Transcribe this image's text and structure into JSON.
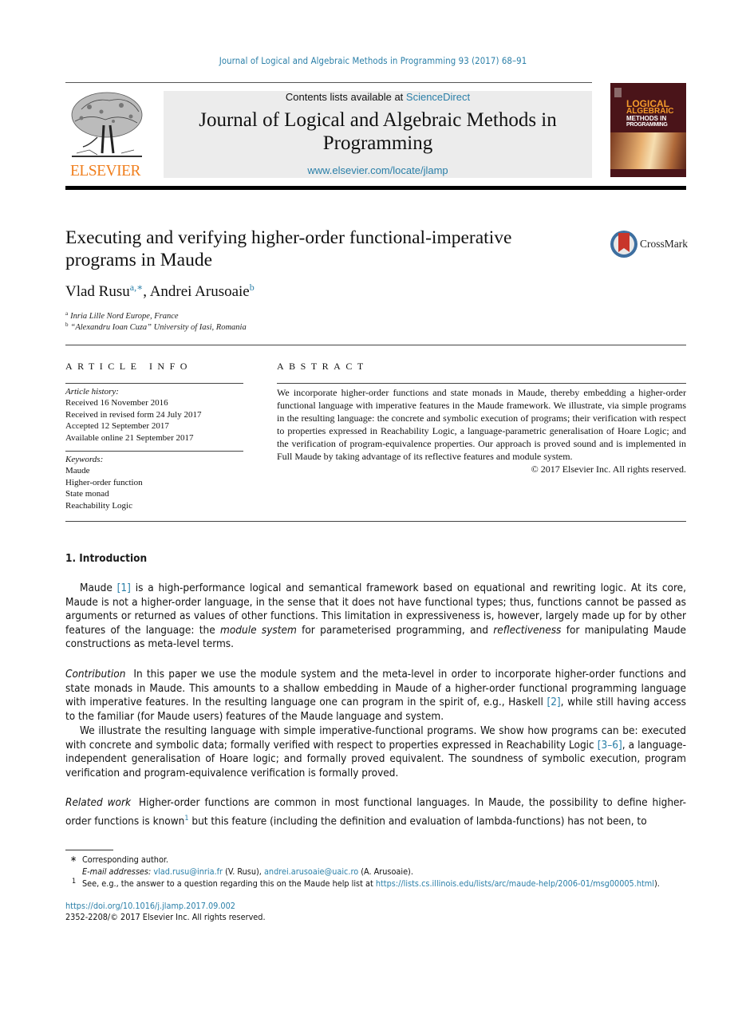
{
  "running_head": "Journal of Logical and Algebraic Methods in Programming 93 (2017) 68–91",
  "publisher": {
    "logo_word": "ELSEVIER",
    "contents_prefix": "Contents lists available at ",
    "contents_link": "ScienceDirect",
    "journal_title_line1": "Journal of Logical and Algebraic Methods in",
    "journal_title_line2": "Programming",
    "journal_url": "www.elsevier.com/locate/jlamp"
  },
  "cover": {
    "line1": "LOGICAL",
    "line2": "ALGEBRAIC",
    "line3": "METHODS IN",
    "line4": "PROGRAMMING",
    "colors": {
      "background": "#4a1419",
      "title_accent": "#f39a2b"
    }
  },
  "crossmark_label": "CrossMark",
  "article": {
    "title_line1": "Executing and verifying higher-order functional-imperative",
    "title_line2": "programs in Maude",
    "authors": [
      {
        "name": "Vlad Rusu",
        "marks": "a,∗"
      },
      {
        "name": "Andrei Arusoaie",
        "marks": "b"
      }
    ],
    "affiliations": [
      {
        "mark": "a",
        "text": "Inria Lille Nord Europe, France"
      },
      {
        "mark": "b",
        "text": "“Alexandru Ioan Cuza” University of Iasi, Romania"
      }
    ]
  },
  "article_info": {
    "heading": "ARTICLE INFO",
    "history_label": "Article history:",
    "history": [
      "Received 16 November 2016",
      "Received in revised form 24 July 2017",
      "Accepted 12 September 2017",
      "Available online 21 September 2017"
    ],
    "keywords_label": "Keywords:",
    "keywords": [
      "Maude",
      "Higher-order function",
      "State monad",
      "Reachability Logic"
    ]
  },
  "abstract": {
    "heading": "ABSTRACT",
    "text": "We incorporate higher-order functions and state monads in Maude, thereby embedding a higher-order functional language with imperative features in the Maude framework. We illustrate, via simple programs in the resulting language: the concrete and symbolic execution of programs; their verification with respect to properties expressed in Reachability Logic, a language-parametric generalisation of Hoare Logic; and the verification of program-equivalence properties. Our approach is proved sound and is implemented in Full Maude by taking advantage of its reflective features and module system.",
    "copyright": "© 2017 Elsevier Inc. All rights reserved."
  },
  "intro": {
    "heading": "1. Introduction",
    "p1_a": "Maude ",
    "p1_ref": "[1]",
    "p1_b": " is a high-performance logical and semantical framework based on equational and rewriting logic. At its core, Maude is not a higher-order language, in the sense that it does not have functional types; thus, functions cannot be passed as arguments or returned as values of other functions. This limitation in expressiveness is, however, largely made up for by other features of the language: the ",
    "p1_em1": "module system",
    "p1_c": " for parameterised programming, and ",
    "p1_em2": "reflectiveness",
    "p1_d": " for manipulating Maude constructions as meta-level terms.",
    "contrib_label": "Contribution",
    "p2_a": "In this paper we use the module system and the meta-level in order to incorporate higher-order functions and state monads in Maude. This amounts to a shallow embedding in Maude of a higher-order functional programming language with imperative features. In the resulting language one can program in the spirit of, e.g., Haskell ",
    "p2_ref": "[2]",
    "p2_b": ", while still having access to the familiar (for Maude users) features of the Maude language and system.",
    "p3_a": "We illustrate the resulting language with simple imperative-functional programs. We show how programs can be: executed with concrete and symbolic data; formally verified with respect to properties expressed in Reachability Logic ",
    "p3_ref": "[3–6]",
    "p3_b": ", a language-independent generalisation of Hoare logic; and formally proved equivalent. The soundness of symbolic execution, program verification and program-equivalence verification is formally proved.",
    "related_label": "Related work",
    "p4_a": "Higher-order functions are common in most functional languages. In Maude, the possibility to define higher-order functions is known",
    "p4_fn": "1",
    "p4_b": " but this feature (including the definition and evaluation of lambda-functions) has not been, to"
  },
  "footnotes": {
    "star_mark": "∗",
    "corresponding": "Corresponding author.",
    "email_label": "E-mail addresses:",
    "email1": "vlad.rusu@inria.fr",
    "email1_who": " (V. Rusu), ",
    "email2": "andrei.arusoaie@uaic.ro",
    "email2_who": " (A. Arusoaie).",
    "fn1_mark": "1",
    "fn1_text": "See, e.g., the answer to a question regarding this on the Maude help list at ",
    "fn1_url": "https://lists.cs.illinois.edu/lists/arc/maude-help/2006-01/msg00005.html",
    "fn1_end": ")."
  },
  "doi": "https://doi.org/10.1016/j.jlamp.2017.09.002",
  "issn_line": "2352-2208/© 2017 Elsevier Inc. All rights reserved.",
  "colors": {
    "link": "#2a7fa8",
    "elsevier_orange": "#f07f1e",
    "masthead_bg": "#ececec"
  }
}
